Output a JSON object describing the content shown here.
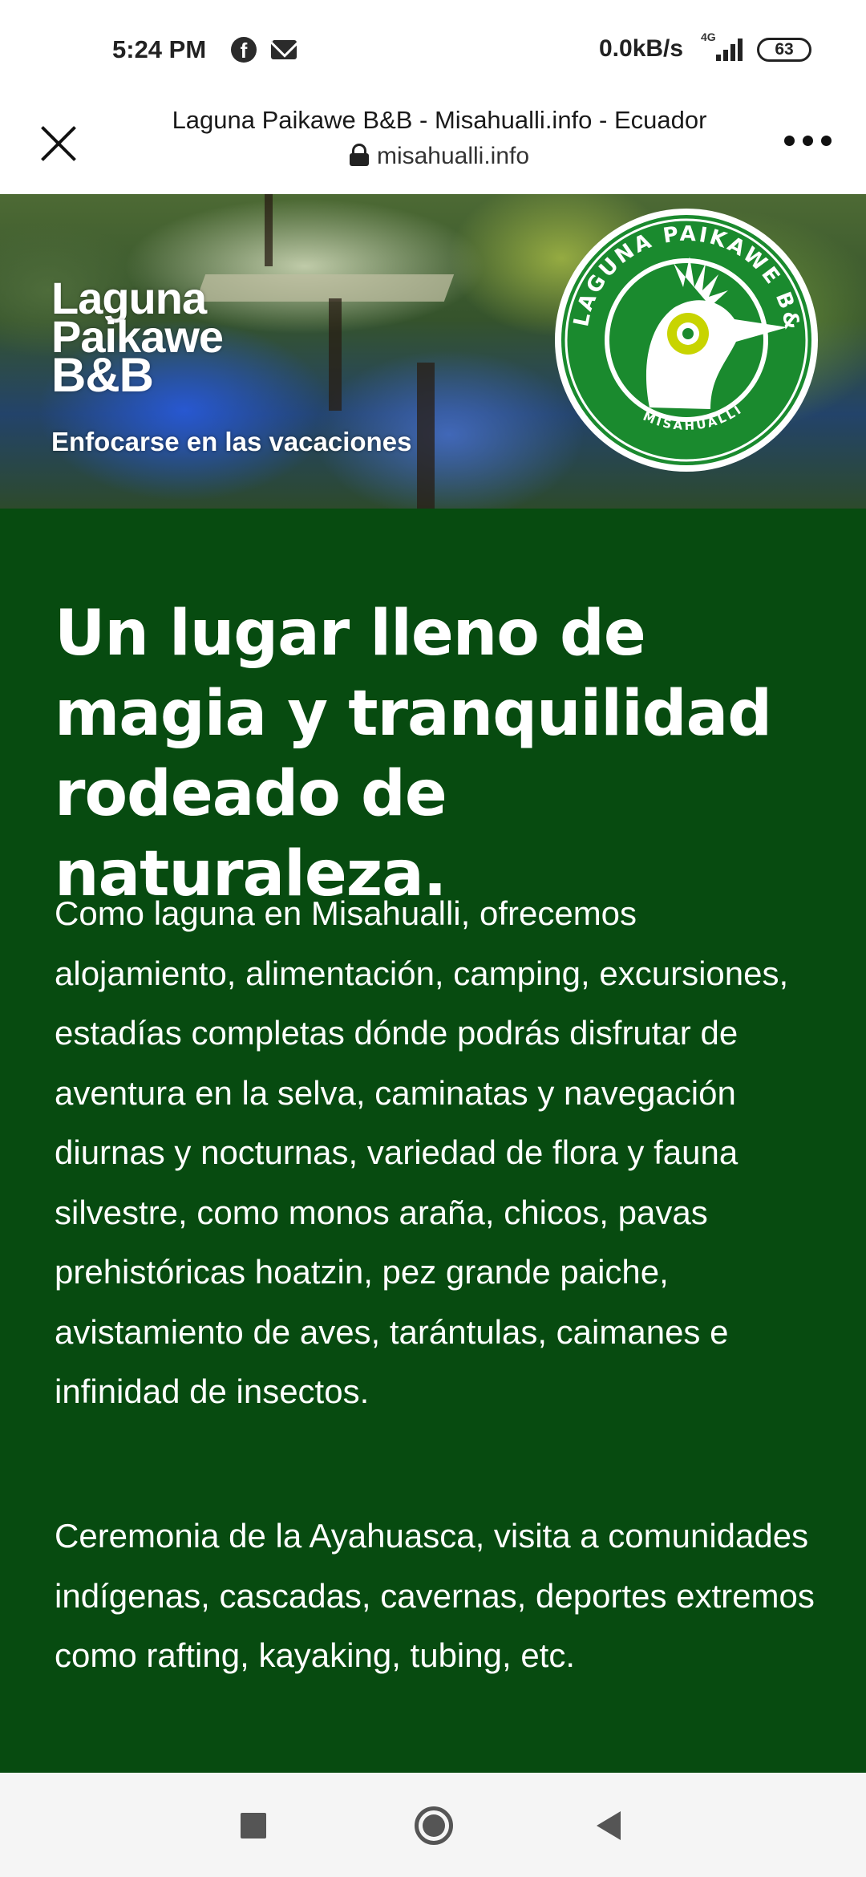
{
  "status_bar": {
    "time": "5:24 PM",
    "net_speed": "0.0kB/s",
    "network_type": "4G",
    "battery": "63",
    "icons": [
      "facebook-icon",
      "mail-icon",
      "signal-icon",
      "battery-icon"
    ]
  },
  "browser": {
    "page_title": "Laguna Paikawe B&B - Misahualli.info - Ecuador",
    "url": "misahualli.info",
    "icons": [
      "close-icon",
      "lock-icon",
      "more-icon"
    ]
  },
  "hero": {
    "title_line1": "Laguna",
    "title_line2": "Paikawe",
    "title_line3": "B&B",
    "tagline": "Enfocarse en las vacaciones",
    "logo_ring_text": "LAGUNA PAIKAWE B&B",
    "logo_sub_text": "MISAHUALLI",
    "colors": {
      "logo_green": "#1a8a2e",
      "logo_yellow": "#c8d400"
    }
  },
  "content": {
    "headline": "Un lugar lleno de magia y tranquilidad rodeado de naturaleza.",
    "paragraph1": "Como laguna en Misahualli, ofrecemos alojamiento, alimentación, camping, excursiones, estadías completas dónde podrás disfrutar de aventura en la selva, caminatas y navegación diurnas y nocturnas, variedad de flora y fauna silvestre, como monos araña, chicos, pavas prehistóricas hoatzin, pez grande paiche, avistamiento de aves, tarántulas, caimanes e infinidad de insectos.",
    "paragraph2": "Ceremonia de la Ayahuasca, visita a comunidades indígenas, cascadas, cavernas, deportes extremos como rafting, kayaking, tubing, etc.",
    "colors": {
      "background": "#074b10",
      "text": "#ffffff"
    }
  },
  "nav_bar": {
    "icons": [
      "recents-icon",
      "home-icon",
      "back-icon"
    ]
  }
}
